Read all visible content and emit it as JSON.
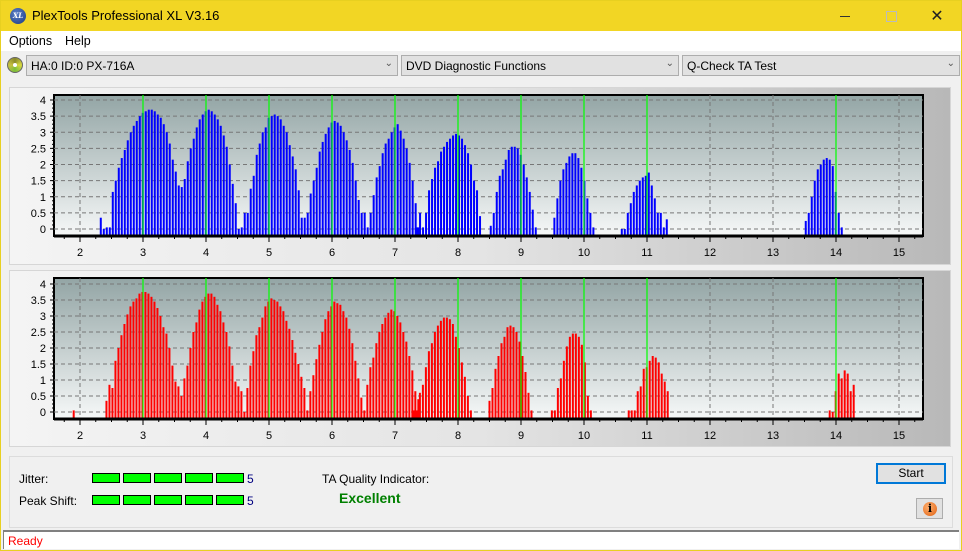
{
  "window": {
    "title": "PlexTools Professional XL V3.16",
    "app_icon": "xl-logo-icon",
    "controls": [
      "minimize",
      "maximize",
      "close"
    ]
  },
  "menu": {
    "items": [
      {
        "label": "Options"
      },
      {
        "label": "Help"
      }
    ]
  },
  "toolbar": {
    "device_icon": "disc-icon",
    "device": "HA:0 ID:0  PX-716A",
    "function_group": "DVD Diagnostic Functions",
    "test": "Q-Check TA Test"
  },
  "results": {
    "jitter_label": "Jitter:",
    "jitter_value": "5",
    "jitter_level": 5,
    "jitter_max": 5,
    "peak_shift_label": "Peak Shift:",
    "peak_shift_value": "5",
    "peak_shift_level": 5,
    "peak_shift_max": 5,
    "ta_label": "TA Quality Indicator:",
    "ta_value": "Excellent",
    "start_label": "Start",
    "info_icon": "info-icon"
  },
  "status": {
    "text": "Ready"
  },
  "colors": {
    "titlebar": "#f2d624",
    "series_top": "#0000ff",
    "series_bottom": "#ff0000",
    "marker_lines": "#00ff00",
    "meter": "#00ff00",
    "quality_text": "#008000",
    "status_text": "#ff0000"
  },
  "chart_data": [
    {
      "type": "bar",
      "name": "top-chart",
      "series_color": "#0000ff",
      "xlim": [
        1.6,
        15.45
      ],
      "ylim": [
        -0.15,
        4.1
      ],
      "xticks": [
        2,
        3,
        4,
        5,
        6,
        7,
        8,
        9,
        10,
        11,
        12,
        13,
        14,
        15
      ],
      "yticks": [
        0,
        0.5,
        1,
        1.5,
        2,
        2.5,
        3,
        3.5,
        4
      ],
      "ytick_labels": [
        "0",
        "0.5",
        "1",
        "1.5",
        "2",
        "2.5",
        "3",
        "3.5",
        "4"
      ],
      "grid": true,
      "marker_lines_x": [
        3,
        4,
        5,
        6,
        7,
        8,
        9,
        10,
        11,
        14
      ],
      "bar_step": 0.0476,
      "clusters": [
        {
          "start": 2.33,
          "values": [
            0.35,
            0,
            0.05,
            0.05,
            1.15,
            1.5,
            1.9,
            2.2,
            2.45,
            2.75,
            3.0,
            3.2,
            3.35,
            3.5,
            3.6,
            3.65,
            3.7,
            3.7,
            3.65,
            3.55,
            3.45,
            3.25,
            3.0,
            2.65,
            2.15,
            1.78,
            1.35,
            1.3,
            1.55,
            2.1,
            2.5,
            2.8,
            3.15,
            3.4,
            3.55,
            3.65,
            3.7,
            3.65,
            3.55,
            3.4,
            3.2,
            2.9,
            2.55,
            2.0,
            1.4,
            0.8,
            0,
            0.05,
            0.5,
            0.5,
            1.25,
            1.65,
            2.3,
            2.65,
            3.0,
            3.15,
            3.45,
            3.5,
            3.55,
            3.5,
            3.4,
            3.2,
            3.0,
            2.6,
            2.25,
            1.85,
            1.2,
            0.35,
            0.35,
            0.5,
            1.1,
            1.5,
            1.9,
            2.4,
            2.7,
            2.95,
            3.15,
            3.3,
            3.35,
            3.3,
            3.2,
            3.0,
            2.75,
            2.45,
            2.05,
            1.5,
            0.9,
            0.5,
            0.5,
            0.05,
            0.5,
            1.05,
            1.6,
            1.95,
            2.35,
            2.65,
            2.8,
            3.0,
            3.15,
            3.25,
            3.05,
            2.8,
            2.5,
            2.05,
            1.5,
            0.8,
            0.05
          ]
        },
        {
          "start": 7.35,
          "values": [
            0.05,
            0.5,
            0.05,
            0.5,
            1.2,
            1.55,
            1.9,
            2.1,
            2.4,
            2.55,
            2.7,
            2.8,
            2.9,
            2.95,
            2.9,
            2.8,
            2.6,
            2.35,
            2.0,
            1.5,
            1.2,
            0.4
          ]
        },
        {
          "start": 8.52,
          "values": [
            0.1,
            0.5,
            1.15,
            1.65,
            1.85,
            2.15,
            2.45,
            2.55,
            2.55,
            2.5,
            2.3,
            2.0,
            1.6,
            1.15,
            0.6,
            0.05
          ]
        },
        {
          "start": 9.53,
          "values": [
            0.35,
            0.95,
            1.5,
            1.85,
            2.05,
            2.25,
            2.35,
            2.35,
            2.2,
            1.9,
            1.5,
            0.95,
            0.5,
            0.05
          ]
        },
        {
          "start": 10.6,
          "values": [
            0.0,
            0.0,
            0.5,
            0.8,
            1.15,
            1.35,
            1.5,
            1.6,
            1.65,
            1.75,
            1.35,
            0.95,
            0.5,
            0.5,
            0.05,
            0.3
          ]
        },
        {
          "start": 13.52,
          "values": [
            0.25,
            0.5,
            1.0,
            1.5,
            1.85,
            2.0,
            2.15,
            2.2,
            2.15,
            1.95,
            1.15,
            0.5,
            0.05
          ]
        }
      ]
    },
    {
      "type": "bar",
      "name": "bottom-chart",
      "series_color": "#ff0000",
      "xlim": [
        1.6,
        15.45
      ],
      "ylim": [
        -0.15,
        4.1
      ],
      "xticks": [
        2,
        3,
        4,
        5,
        6,
        7,
        8,
        9,
        10,
        11,
        12,
        13,
        14,
        15
      ],
      "yticks": [
        0,
        0.5,
        1,
        1.5,
        2,
        2.5,
        3,
        3.5,
        4
      ],
      "ytick_labels": [
        "0",
        "0.5",
        "1",
        "1.5",
        "2",
        "2.5",
        "3",
        "3.5",
        "4"
      ],
      "grid": true,
      "marker_lines_x": [
        3,
        4,
        5,
        6,
        7,
        8,
        9,
        10,
        11,
        14
      ],
      "bar_step": 0.0476,
      "clusters": [
        {
          "start": 1.9,
          "values": [
            0.05
          ]
        },
        {
          "start": 2.42,
          "values": [
            0.35,
            0.85,
            0.75,
            1.6,
            2.0,
            2.4,
            2.75,
            3.05,
            3.3,
            3.45,
            3.55,
            3.7,
            3.75,
            3.75,
            3.7,
            3.6,
            3.45,
            3.25,
            3.0,
            2.65,
            2.45,
            2.0,
            1.45,
            0.95,
            0.8,
            0.5,
            1.05,
            1.45,
            2.0,
            2.5,
            2.8,
            3.2,
            3.45,
            3.6,
            3.7,
            3.7,
            3.6,
            3.35,
            3.15,
            2.8,
            2.5,
            2.05,
            1.45,
            0.95,
            0.8,
            0.65,
            0,
            0.75,
            1.45,
            1.9,
            2.4,
            2.65,
            2.95,
            3.3,
            3.45,
            3.55,
            3.5,
            3.45,
            3.3,
            3.15,
            2.85,
            2.6,
            2.25,
            1.85,
            1.5,
            1.1,
            0.75,
            0.05,
            0.65,
            1.15,
            1.65,
            2.1,
            2.5,
            2.9,
            3.15,
            3.3,
            3.45,
            3.4,
            3.35,
            3.15,
            2.95,
            2.6,
            2.15,
            1.6,
            1.05,
            0.45,
            0.05,
            0.85,
            1.4,
            1.7,
            2.15,
            2.5,
            2.75,
            2.95,
            3.1,
            3.2,
            3.15,
            3.0,
            2.8,
            2.5,
            2.2,
            1.75,
            1.3,
            0.65,
            0.4
          ]
        },
        {
          "start": 7.3,
          "values": [
            0.05,
            0.05,
            0.6,
            0.85,
            1.4,
            1.9,
            2.15,
            2.5,
            2.7,
            2.85,
            2.95,
            2.95,
            2.9,
            2.75,
            2.35,
            2.0,
            1.55,
            1.1,
            0.5,
            0.05
          ]
        },
        {
          "start": 8.5,
          "values": [
            0.35,
            0.75,
            1.35,
            1.75,
            2.15,
            2.35,
            2.65,
            2.7,
            2.65,
            2.5,
            2.2,
            1.75,
            1.25,
            0.6,
            0.05
          ]
        },
        {
          "start": 9.49,
          "values": [
            0.05,
            0.05,
            0.75,
            1.05,
            1.6,
            2.05,
            2.35,
            2.45,
            2.45,
            2.35,
            2.1,
            1.55,
            0.5,
            0.05
          ]
        },
        {
          "start": 10.71,
          "values": [
            0.05,
            0.05,
            0.05,
            0.65,
            0.8,
            1.35,
            1.4,
            1.6,
            1.75,
            1.7,
            1.55,
            1.2,
            0.95,
            0.65
          ]
        },
        {
          "start": 13.9,
          "values": [
            0.05,
            0.0,
            0.65,
            1.2,
            1.05,
            1.3,
            1.2,
            0.65,
            0.85
          ]
        }
      ]
    }
  ]
}
